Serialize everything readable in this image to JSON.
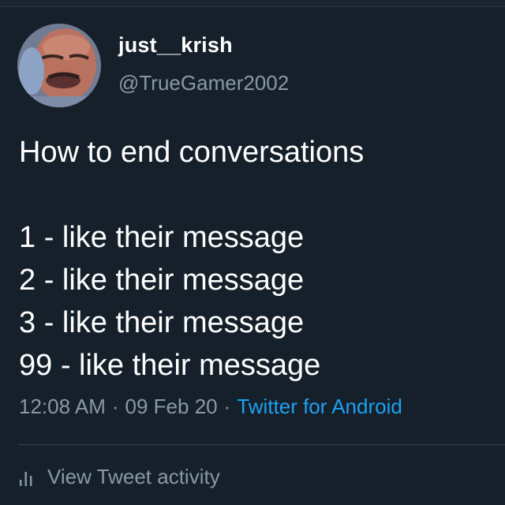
{
  "user": {
    "display_name": "just__krish",
    "handle": "@TrueGamer2002"
  },
  "tweet": {
    "lines": [
      "How to end conversations",
      "",
      "1 - like their message",
      "2 - like their message",
      "3 - like their message",
      "99 - like their message"
    ],
    "time": "12:08 AM",
    "date": "09 Feb 20",
    "separator": "·",
    "source": "Twitter for Android"
  },
  "actions": {
    "activity_label": "View Tweet activity",
    "activity_icon": "bar-chart-icon"
  },
  "colors": {
    "background": "#15202b",
    "text": "#ffffff",
    "secondary": "#8899a6",
    "accent": "#1da1f2"
  }
}
